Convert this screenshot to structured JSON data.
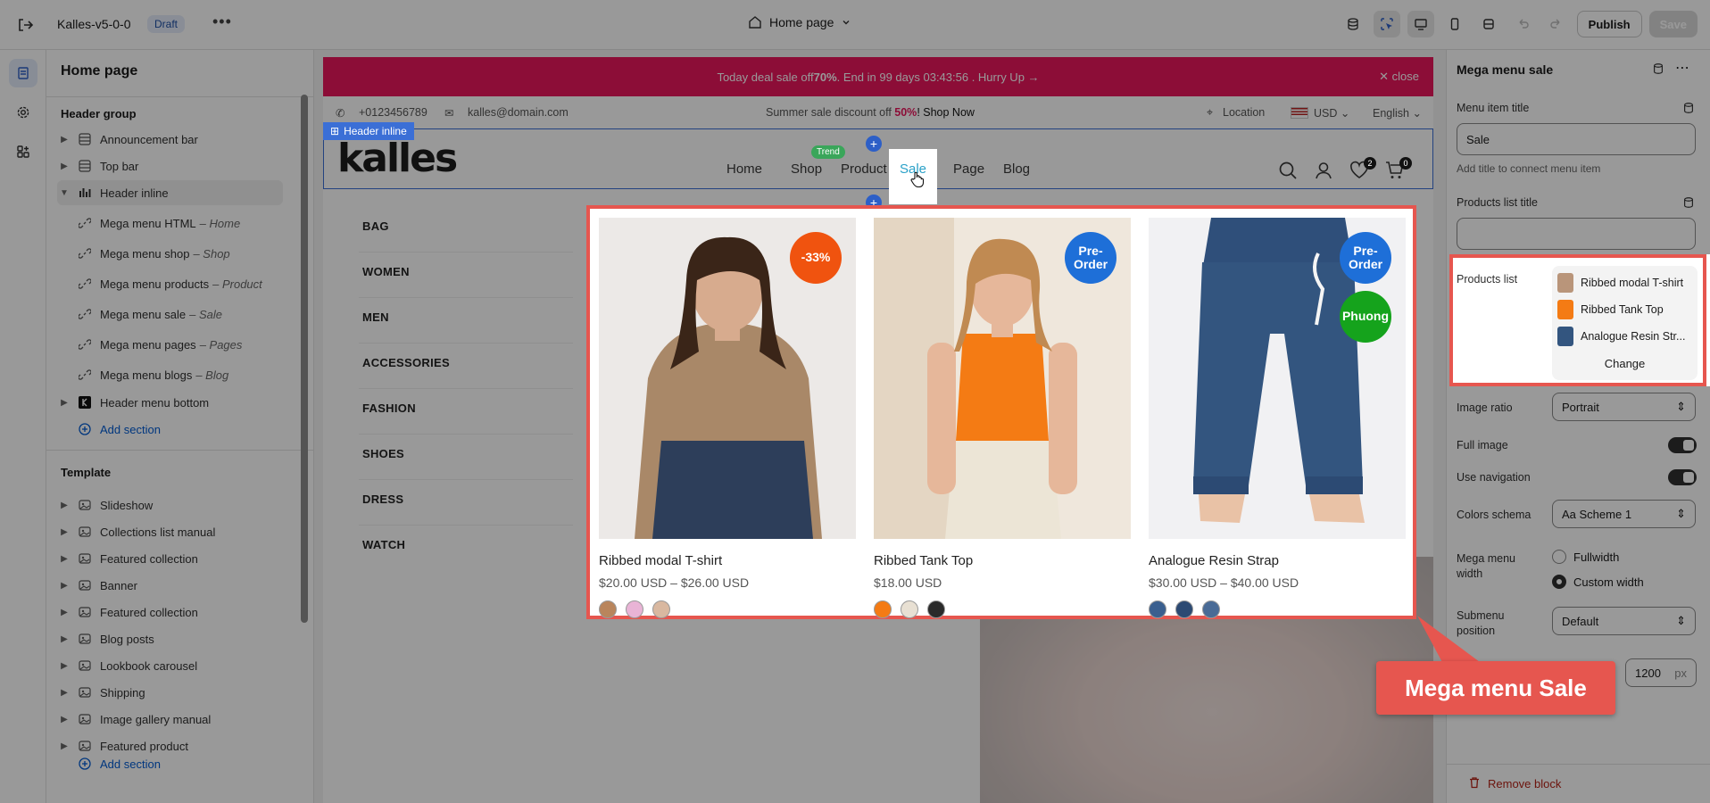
{
  "topbar": {
    "theme_name": "Kalles-v5-0-0",
    "status": "Draft",
    "page_selector": "Home page",
    "publish": "Publish",
    "save": "Save"
  },
  "sidebar": {
    "title": "Home page",
    "header_group": "Header group",
    "header_items": [
      {
        "label": "Announcement bar"
      },
      {
        "label": "Top bar"
      },
      {
        "label": "Header inline"
      }
    ],
    "header_inline_children": [
      {
        "label": "Mega menu HTML",
        "sub": "– Home"
      },
      {
        "label": "Mega menu shop",
        "sub": "– Shop"
      },
      {
        "label": "Mega menu products",
        "sub": "– Product"
      },
      {
        "label": "Mega menu sale",
        "sub": "– Sale"
      },
      {
        "label": "Mega menu pages",
        "sub": "– Pages"
      },
      {
        "label": "Mega menu blogs",
        "sub": "– Blog"
      }
    ],
    "header_menu_bottom": "Header menu bottom",
    "add_section": "Add section",
    "template": "Template",
    "template_items": [
      {
        "label": "Slideshow"
      },
      {
        "label": "Collections list manual"
      },
      {
        "label": "Featured collection"
      },
      {
        "label": "Banner"
      },
      {
        "label": "Featured collection"
      },
      {
        "label": "Blog posts"
      },
      {
        "label": "Lookbook carousel"
      },
      {
        "label": "Shipping"
      },
      {
        "label": "Image gallery manual"
      },
      {
        "label": "Featured product"
      }
    ],
    "add_section_2": "Add section"
  },
  "store": {
    "promo_pre": "Today deal sale off ",
    "promo_bold": "70%",
    "promo_post": ". End in 99 days 03:43:56 .  Hurry Up →",
    "promo_close": "✕ close",
    "phone": "+0123456789",
    "email": "kalles@domain.com",
    "summer_pre": "Summer sale discount off ",
    "summer_pct": "50%",
    "summer_post": "! Shop Now",
    "location": "Location",
    "currency": "USD",
    "language": "English",
    "header_tag": "Header inline",
    "logo": "kalles",
    "nav": [
      "Home",
      "Shop",
      "Product",
      "Sale",
      "Page",
      "Blog"
    ],
    "trend": "Trend",
    "wishlist_count": "2",
    "cart_count": "0",
    "categories": [
      "BAG",
      "WOMEN",
      "MEN",
      "ACCESSORIES",
      "FASHION",
      "SHOES",
      "DRESS",
      "WATCH"
    ]
  },
  "mega": {
    "products": [
      {
        "name": "Ribbed modal T-shirt",
        "price": "$20.00 USD – $26.00 USD",
        "badges": [
          "-33%"
        ],
        "badge_colors": [
          "#f0530f"
        ],
        "swatches": [
          "#b9855c",
          "#e9b4d6",
          "#d9b8a0"
        ]
      },
      {
        "name": "Ribbed Tank Top",
        "price": "$18.00 USD",
        "badges": [
          "Pre-\nOrder"
        ],
        "badge_colors": [
          "#1e6fd8"
        ],
        "swatches": [
          "#f47b14",
          "#e8e0d3",
          "#2a2a2a"
        ]
      },
      {
        "name": "Analogue Resin Strap",
        "price": "$30.00 USD – $40.00 USD",
        "badges": [
          "Pre-\nOrder",
          "Phuong"
        ],
        "badge_colors": [
          "#1e6fd8",
          "#15a31c"
        ],
        "swatches": [
          "#3a5f8f",
          "#2c4a73",
          "#4a6b96"
        ]
      }
    ]
  },
  "rpanel": {
    "title": "Mega menu sale",
    "menu_item_title_label": "Menu item title",
    "menu_item_title_value": "Sale",
    "menu_item_help": "Add title to connect menu item",
    "products_list_title_label": "Products list title",
    "products_list_title_value": "",
    "products_list_label": "Products list",
    "products_list": [
      "Ribbed modal T-shirt",
      "Ribbed Tank Top",
      "Analogue Resin Str..."
    ],
    "change": "Change",
    "image_ratio_label": "Image ratio",
    "image_ratio_value": "Portrait",
    "full_image_label": "Full image",
    "use_navigation_label": "Use navigation",
    "colors_schema_label": "Colors schema",
    "colors_schema_value": "Scheme 1",
    "mega_width_label": "Mega menu width",
    "width_opt1": "Fullwidth",
    "width_opt2": "Custom width",
    "submenu_pos_label": "Submenu position",
    "submenu_pos_value": "Default",
    "width_px_value": "1200",
    "width_px_unit": "px",
    "remove_block": "Remove block"
  },
  "callout": "Mega menu Sale"
}
